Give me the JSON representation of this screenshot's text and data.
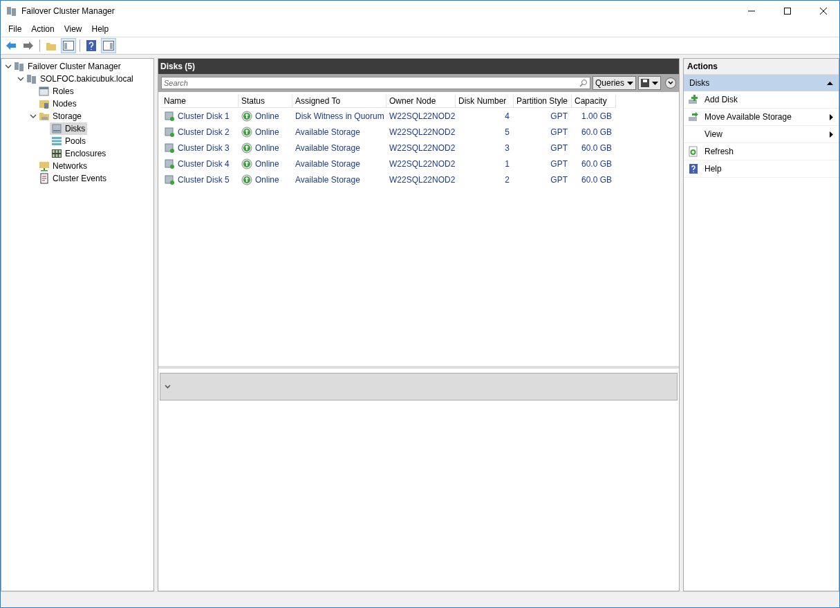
{
  "window": {
    "title": "Failover Cluster Manager"
  },
  "menu": [
    "File",
    "Action",
    "View",
    "Help"
  ],
  "tree": [
    {
      "label": "Failover Cluster Manager",
      "selected": false,
      "expanded": true,
      "children": [
        {
          "label": "SOLFOC.bakicubuk.local",
          "selected": false,
          "expanded": true,
          "children": [
            {
              "label": "Roles",
              "selected": false
            },
            {
              "label": "Nodes",
              "selected": false
            },
            {
              "label": "Storage",
              "selected": false,
              "expanded": true,
              "children": [
                {
                  "label": "Disks",
                  "selected": true
                },
                {
                  "label": "Pools",
                  "selected": false
                },
                {
                  "label": "Enclosures",
                  "selected": false
                }
              ]
            },
            {
              "label": "Networks",
              "selected": false
            },
            {
              "label": "Cluster Events",
              "selected": false
            }
          ]
        }
      ]
    }
  ],
  "disks": {
    "title": "Disks (5)",
    "search": {
      "placeholder": "Search"
    },
    "queries": "Queries",
    "columns": [
      "Name",
      "Status",
      "Assigned To",
      "Owner Node",
      "Disk Number",
      "Partition Style",
      "Capacity"
    ],
    "rows": [
      {
        "name": "Cluster Disk 1",
        "status": "Online",
        "assigned_to": "Disk Witness in Quorum",
        "owner_node": "W22SQL22NOD2",
        "disk_number": "4",
        "partition_style": "GPT",
        "capacity": "1.00 GB"
      },
      {
        "name": "Cluster Disk 2",
        "status": "Online",
        "assigned_to": "Available Storage",
        "owner_node": "W22SQL22NOD2",
        "disk_number": "5",
        "partition_style": "GPT",
        "capacity": "60.0 GB"
      },
      {
        "name": "Cluster Disk 3",
        "status": "Online",
        "assigned_to": "Available Storage",
        "owner_node": "W22SQL22NOD2",
        "disk_number": "3",
        "partition_style": "GPT",
        "capacity": "60.0 GB"
      },
      {
        "name": "Cluster Disk 4",
        "status": "Online",
        "assigned_to": "Available Storage",
        "owner_node": "W22SQL22NOD2",
        "disk_number": "1",
        "partition_style": "GPT",
        "capacity": "60.0 GB"
      },
      {
        "name": "Cluster Disk 5",
        "status": "Online",
        "assigned_to": "Available Storage",
        "owner_node": "W22SQL22NOD2",
        "disk_number": "2",
        "partition_style": "GPT",
        "capacity": "60.0 GB"
      }
    ]
  },
  "actions": {
    "title": "Actions",
    "section": {
      "label": "Disks",
      "expanded": true
    },
    "items": [
      {
        "label": "Add Disk",
        "submenu": false
      },
      {
        "label": "Move Available Storage",
        "submenu": true
      },
      {
        "label": "View",
        "submenu": true
      },
      {
        "label": "Refresh",
        "submenu": false
      },
      {
        "label": "Help",
        "submenu": false
      }
    ]
  }
}
